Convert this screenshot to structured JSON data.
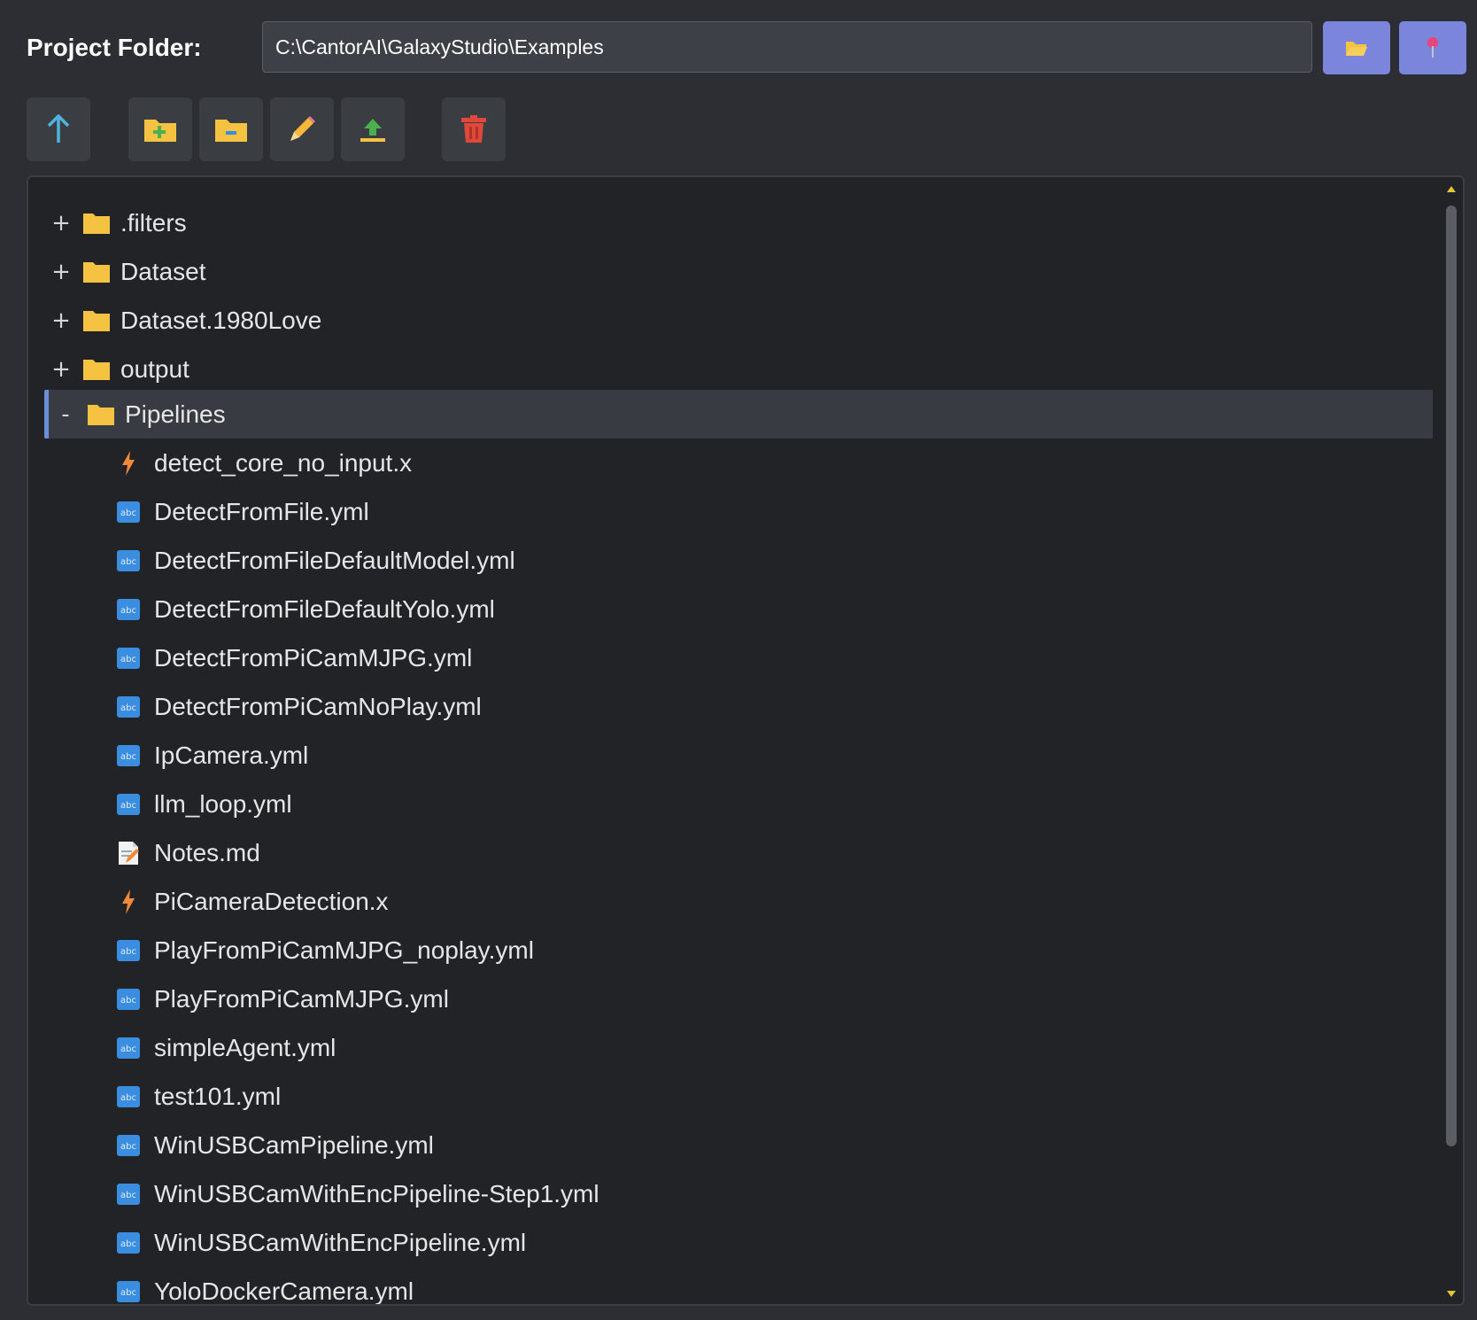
{
  "header": {
    "folder_label": "Project Folder:",
    "folder_path": "C:\\CantorAI\\GalaxyStudio\\Examples",
    "browse_icon": "folder-open-icon",
    "pin_icon": "pin-icon"
  },
  "toolbar": {
    "buttons": [
      {
        "name": "up-button",
        "icon": "arrow-up-icon"
      },
      {
        "name": "new-folder-button",
        "icon": "folder-plus-icon"
      },
      {
        "name": "new-file-button",
        "icon": "folder-minus-icon"
      },
      {
        "name": "rename-button",
        "icon": "pencil-icon"
      },
      {
        "name": "upload-button",
        "icon": "upload-icon"
      },
      {
        "name": "delete-button",
        "icon": "trash-icon"
      }
    ]
  },
  "tree": {
    "folders": [
      {
        "toggle": "+",
        "label": ".filters"
      },
      {
        "toggle": "+",
        "label": "Dataset"
      },
      {
        "toggle": "+",
        "label": "Dataset.1980Love"
      },
      {
        "toggle": "+",
        "label": "output"
      },
      {
        "toggle": "-",
        "label": "Pipelines",
        "selected": true
      }
    ],
    "files": [
      {
        "label": "detect_core_no_input.x",
        "icon": "lightning-icon"
      },
      {
        "label": "DetectFromFile.yml",
        "icon": "text-file-icon"
      },
      {
        "label": "DetectFromFileDefaultModel.yml",
        "icon": "text-file-icon"
      },
      {
        "label": "DetectFromFileDefaultYolo.yml",
        "icon": "text-file-icon"
      },
      {
        "label": "DetectFromPiCamMJPG.yml",
        "icon": "text-file-icon"
      },
      {
        "label": "DetectFromPiCamNoPlay.yml",
        "icon": "text-file-icon"
      },
      {
        "label": "IpCamera.yml",
        "icon": "text-file-icon"
      },
      {
        "label": "llm_loop.yml",
        "icon": "text-file-icon"
      },
      {
        "label": "Notes.md",
        "icon": "memo-icon"
      },
      {
        "label": "PiCameraDetection.x",
        "icon": "lightning-icon"
      },
      {
        "label": "PlayFromPiCamMJPG_noplay.yml",
        "icon": "text-file-icon"
      },
      {
        "label": "PlayFromPiCamMJPG.yml",
        "icon": "text-file-icon"
      },
      {
        "label": "simpleAgent.yml",
        "icon": "text-file-icon"
      },
      {
        "label": "test101.yml",
        "icon": "text-file-icon"
      },
      {
        "label": "WinUSBCamPipeline.yml",
        "icon": "text-file-icon"
      },
      {
        "label": "WinUSBCamWithEncPipeline-Step1.yml",
        "icon": "text-file-icon"
      },
      {
        "label": "WinUSBCamWithEncPipeline.yml",
        "icon": "text-file-icon"
      },
      {
        "label": "YoloDockerCamera.yml",
        "icon": "text-file-icon"
      }
    ]
  },
  "colors": {
    "background": "#2c2e33",
    "panel": "#212327",
    "accent_button": "#7b85dc",
    "folder_yellow": "#f5c242",
    "file_blue": "#3b8de0",
    "lightning_orange": "#f08a3a",
    "delete_red": "#e0483c",
    "up_arrow_teal": "#4fb3e0"
  }
}
